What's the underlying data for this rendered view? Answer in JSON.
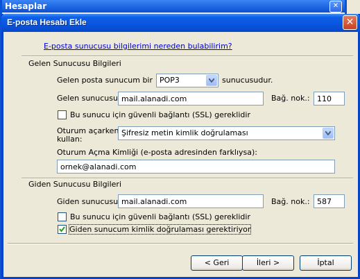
{
  "background_window": {
    "title": "Hesaplar"
  },
  "dialog": {
    "title": "E-posta Hesabı Ekle",
    "help_link": "E-posta sunucusu bilgilerimi nereden bulabilirim?",
    "incoming": {
      "section_label": "Gelen Sunucusu Bilgileri",
      "server_type_prefix": "Gelen posta sunucum bir",
      "server_type_value": "POP3",
      "server_type_suffix": "sunucusudur.",
      "server_label": "Gelen sunucusu:",
      "server_value": "mail.alanadi.com",
      "port_label": "Bağ. nok.:",
      "port_value": "110",
      "ssl_label": "Bu sunucu için güvenli bağlantı (SSL) gereklidir",
      "ssl_checked": false,
      "logon_label_line1": "Oturum açarken",
      "logon_label_line2": "kullan:",
      "logon_value": "Şifresiz metin kimlik doğrulaması",
      "logon_id_label": "Oturum Açma Kimliği (e-posta adresinden farklıysa):",
      "logon_id_value": "ornek@alanadi.com"
    },
    "outgoing": {
      "section_label": "Giden Sunucusu Bilgileri",
      "server_label": "Giden sunucusu:",
      "server_value": "mail.alanadi.com",
      "port_label": "Bağ. nok.:",
      "port_value": "587",
      "ssl_label": "Bu sunucu için güvenli bağlantı (SSL) gereklidir",
      "ssl_checked": false,
      "auth_label": "Giden sunucum kimlik doğrulaması gerektiriyor",
      "auth_checked": true
    },
    "buttons": {
      "back": "< Geri",
      "next": "İleri >",
      "cancel": "İptal"
    }
  },
  "colors": {
    "titlebar": "#0A55DD",
    "dialog_bg": "#ECE9D8",
    "link": "#0000CC",
    "close_button": "#C8411F"
  }
}
